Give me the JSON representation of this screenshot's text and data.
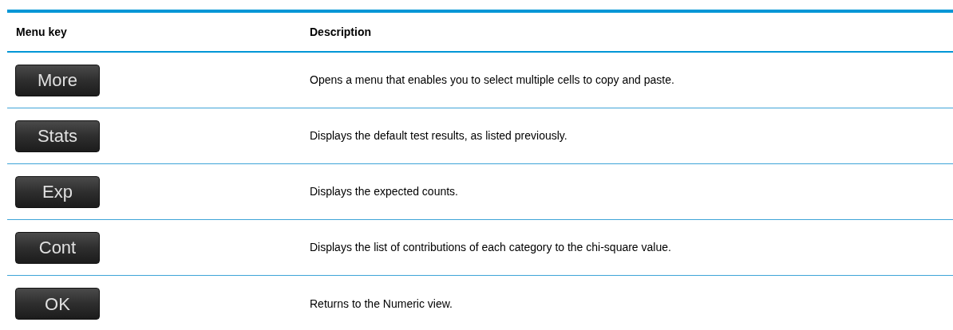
{
  "table": {
    "columns": [
      "Menu key",
      "Description"
    ],
    "rows": [
      {
        "key": "More",
        "description": "Opens a menu that enables you to select multiple cells to copy and paste."
      },
      {
        "key": "Stats",
        "description": "Displays the default test results, as listed previously."
      },
      {
        "key": "Exp",
        "description": "Displays the expected counts."
      },
      {
        "key": "Cont",
        "description": "Displays the list of contributions of each category to the chi-square value."
      },
      {
        "key": "OK",
        "description": "Returns to the Numeric view."
      }
    ]
  }
}
